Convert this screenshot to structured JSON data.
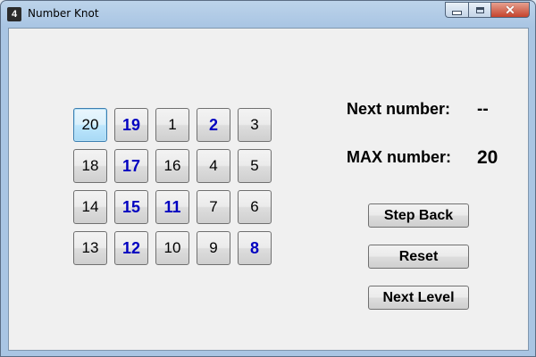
{
  "window": {
    "title": "Number Knot",
    "icon_text": "4"
  },
  "grid": {
    "cells": [
      {
        "label": "20",
        "style": "selected"
      },
      {
        "label": "19",
        "style": "blue"
      },
      {
        "label": "1",
        "style": "normal"
      },
      {
        "label": "2",
        "style": "blue"
      },
      {
        "label": "3",
        "style": "normal"
      },
      {
        "label": "18",
        "style": "normal"
      },
      {
        "label": "17",
        "style": "blue"
      },
      {
        "label": "16",
        "style": "normal"
      },
      {
        "label": "4",
        "style": "normal"
      },
      {
        "label": "5",
        "style": "normal"
      },
      {
        "label": "14",
        "style": "normal"
      },
      {
        "label": "15",
        "style": "blue"
      },
      {
        "label": "11",
        "style": "blue"
      },
      {
        "label": "7",
        "style": "normal"
      },
      {
        "label": "6",
        "style": "normal"
      },
      {
        "label": "13",
        "style": "normal"
      },
      {
        "label": "12",
        "style": "blue"
      },
      {
        "label": "10",
        "style": "normal"
      },
      {
        "label": "9",
        "style": "normal"
      },
      {
        "label": "8",
        "style": "blue"
      }
    ]
  },
  "info": {
    "next_label": "Next number:",
    "next_value": "--",
    "max_label": "MAX number:",
    "max_value": "20"
  },
  "buttons": {
    "step_back": "Step Back",
    "reset": "Reset",
    "next_level": "Next Level"
  },
  "colors": {
    "blue_number": "#0000c0",
    "selected_border": "#3c7fb1"
  }
}
